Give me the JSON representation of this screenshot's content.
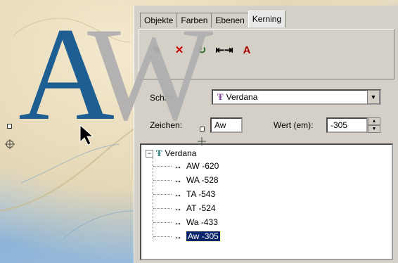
{
  "sample_text": {
    "first": "A",
    "second": "W"
  },
  "tabs": [
    {
      "label": "Objekte"
    },
    {
      "label": "Farben"
    },
    {
      "label": "Ebenen"
    },
    {
      "label": "Kerning"
    }
  ],
  "active_tab": "Kerning",
  "toolbar": {
    "icons": [
      "pen-icon",
      "delete-icon",
      "reset-icon",
      "kerning-expand-icon",
      "kerning-apply-icon"
    ]
  },
  "form": {
    "font_label": "Schrift:",
    "font_value": "Verdana",
    "chars_label": "Zeichen:",
    "chars_value": "Aw",
    "value_label": "Wert (em):",
    "value_value": "-305"
  },
  "tree": {
    "root": "Verdana",
    "items": [
      {
        "label": "AW -620"
      },
      {
        "label": "WA -528"
      },
      {
        "label": "TA -543"
      },
      {
        "label": "AT -524"
      },
      {
        "label": "Wa -433"
      },
      {
        "label": "Aw -305"
      }
    ],
    "selected_index": 5
  },
  "colors": {
    "letter_a": "#1d5f93",
    "letter_w": "#b0b0b0",
    "selection": "#0a246a",
    "panel": "#d4d0c8"
  }
}
